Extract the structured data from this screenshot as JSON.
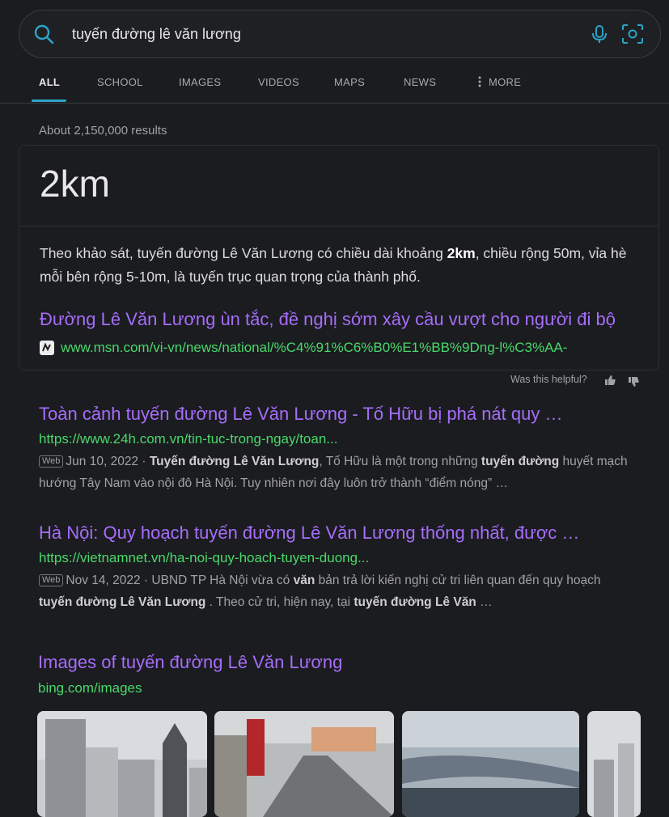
{
  "search": {
    "query": "tuyến đường lê văn lương"
  },
  "tabs": [
    {
      "label": "ALL"
    },
    {
      "label": "SCHOOL"
    },
    {
      "label": "IMAGES"
    },
    {
      "label": "VIDEOS"
    },
    {
      "label": "MAPS"
    },
    {
      "label": "NEWS"
    },
    {
      "label": "MORE"
    }
  ],
  "result_count": "About 2,150,000 results",
  "answer": {
    "value": "2km",
    "text_1": "Theo khảo sát, tuyến đường Lê Văn Lương có chiều dài khoảng ",
    "text_bold": "2km",
    "text_2": ", chiều rộng 50m, vỉa hè mỗi bên rộng 5-10m, là tuyến trục quan trọng của thành phố.",
    "link_title": "Đường Lê Văn Lương ùn tắc, đề nghị sớm xây cầu vượt cho người đi bộ",
    "link_url": "www.msn.com/vi-vn/news/national/%C4%91%C6%B0%E1%BB%9Dng-l%C3%AA-"
  },
  "helpful": {
    "label": "Was this helpful?"
  },
  "results": [
    {
      "title": "Toàn cảnh tuyến đường Lê Văn Lương - Tố Hữu bị phá nát quy …",
      "url": "https://www.24h.com.vn/tin-tuc-trong-ngay/toan...",
      "badge": "Web",
      "date": "Jun 10, 2022 · ",
      "s1": "Tuyến đường Lê Văn Lương",
      "s2": ", Tố Hữu là một trong những ",
      "s3": "tuyến đường",
      "s4": " huyết mạch hướng Tây Nam vào nội đô Hà Nội. Tuy nhiên nơi đây luôn trở thành “điểm nóng” …"
    },
    {
      "title": "Hà Nội: Quy hoạch tuyến đường Lê Văn Lương thống nhất, được …",
      "url": "https://vietnamnet.vn/ha-noi-quy-hoach-tuyen-duong...",
      "badge": "Web",
      "date": "Nov 14, 2022 · ",
      "s1": "UBND TP Hà Nội vừa có ",
      "s2": "văn",
      "s3": " bản trả lời kiến nghị cử tri liên quan đến quy hoạch ",
      "s4": "tuyến đường Lê Văn Lương",
      "s5": " . Theo cử tri, hiện nay, tại ",
      "s6": "tuyến đường Lê Văn",
      "s7": " …"
    }
  ],
  "images": {
    "title": "Images of tuyến đường Lê Văn Lương",
    "url": "bing.com/images"
  },
  "colors": {
    "link": "#a66dfc",
    "url": "#49d96c",
    "accent": "#2ba4c8",
    "background": "#1b1c1f"
  }
}
